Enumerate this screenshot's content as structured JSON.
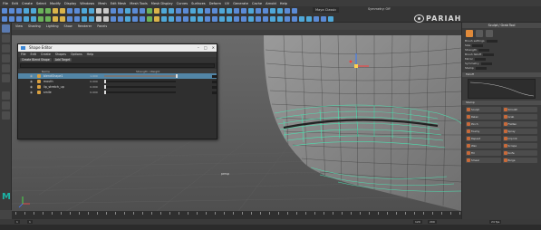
{
  "menubar": {
    "items": [
      "File",
      "Edit",
      "Create",
      "Select",
      "Modify",
      "Display",
      "Windows",
      "Mesh",
      "Edit Mesh",
      "Mesh Tools",
      "Mesh Display",
      "Curves",
      "Surfaces",
      "Deform",
      "UV",
      "Generate",
      "Cache",
      "Arnold",
      "Help"
    ],
    "workspace": "Maya Classic",
    "symmetry": "Symmetry: Off"
  },
  "viewport_menu": [
    "View",
    "Shading",
    "Lighting",
    "Show",
    "Renderer",
    "Panels"
  ],
  "shape_editor": {
    "title": "Shape Editor",
    "menu": [
      "File",
      "Edit",
      "Create",
      "Shapes",
      "Options",
      "Help"
    ],
    "tabs": [
      "Create Blend Shape",
      "Add Target"
    ],
    "header": {
      "name": "Name",
      "strength": "Strength / Weight"
    },
    "rows": [
      {
        "label": "blendShape1",
        "value": "1.000",
        "fill": 1.0,
        "selected": true
      },
      {
        "label": "mouth",
        "value": "0.000",
        "fill": 0.0,
        "selected": false
      },
      {
        "label": "lip_stretch_up",
        "value": "0.000",
        "fill": 0.0,
        "selected": false
      },
      {
        "label": "smile",
        "value": "0.000",
        "fill": 0.0,
        "selected": false
      }
    ]
  },
  "persp_label": "persp",
  "logo_text": "PARIAH",
  "right_panel": {
    "title": "Sculpt / Grab Tool",
    "lines": [
      "Brush settings",
      "Size",
      "Strength",
      "Brush falloff",
      "Mirror",
      "Symmetry",
      "Stamp"
    ],
    "section_falloff": "Falloff",
    "section_stamp": "Stamp",
    "buttons": [
      "Sculpt",
      "Smooth",
      "Relax",
      "Grab",
      "Pinch",
      "Flatten",
      "Foamy",
      "Spray",
      "Repeat",
      "Imprint",
      "Wax",
      "Scrape",
      "Fill",
      "Knife",
      "Smear",
      "Bulge"
    ]
  },
  "range": {
    "start": "1",
    "end": "120",
    "anim_end": "200",
    "fps": "24 fps"
  },
  "colors": {
    "wireframe": "#4de0b0",
    "selection": "#5285a6",
    "accent": "#e08a3a"
  }
}
